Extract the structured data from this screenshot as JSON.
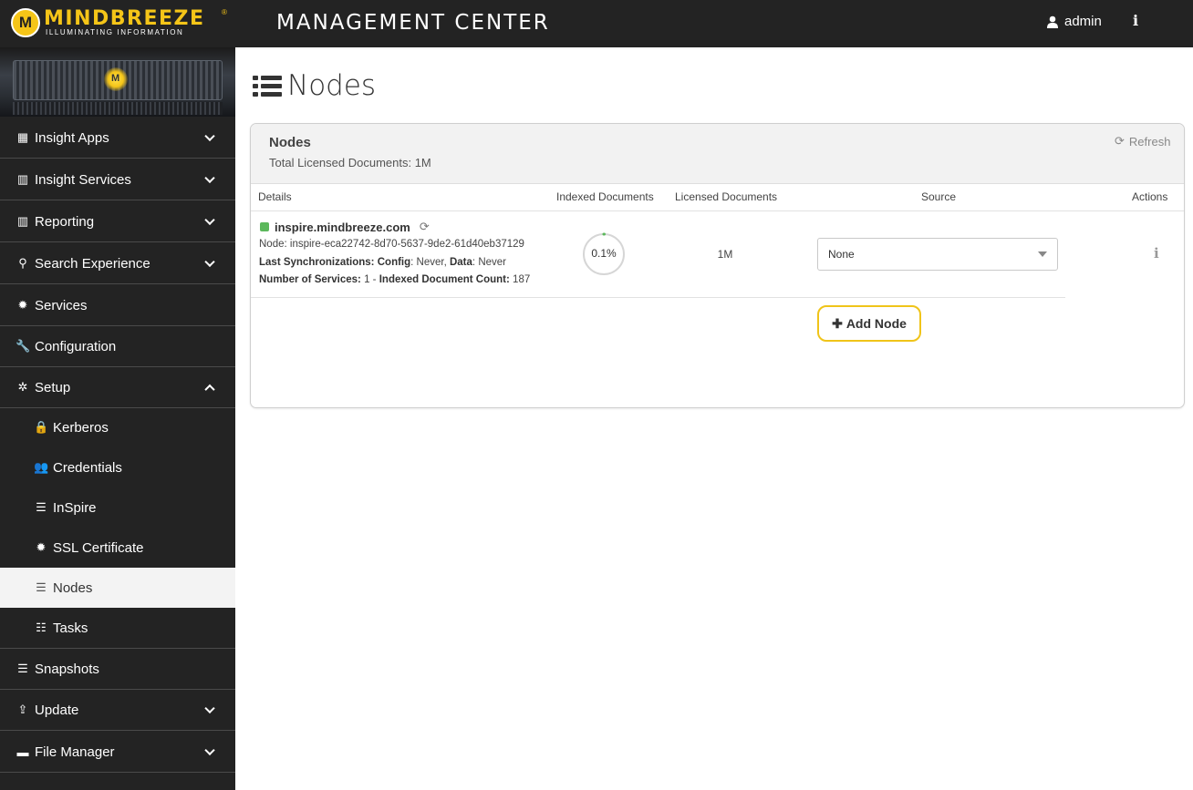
{
  "header": {
    "logo_name": "MINDBREEZE",
    "logo_reg": "®",
    "logo_tagline": "ILLUMINATING INFORMATION",
    "logo_letter": "M",
    "title": "MANAGEMENT CENTER",
    "user_label": "admin",
    "info_glyph": "i"
  },
  "sidebar": {
    "items": [
      {
        "label": "Insight Apps",
        "icon": "grid-icon",
        "glyph": "▦"
      },
      {
        "label": "Insight Services",
        "icon": "bar-chart-icon",
        "glyph": "▥"
      },
      {
        "label": "Reporting",
        "icon": "bar-chart-icon",
        "glyph": "▥"
      },
      {
        "label": "Search Experience",
        "icon": "search-icon",
        "glyph": "⚲"
      },
      {
        "label": "Services",
        "icon": "gear-icon",
        "glyph": "✹"
      },
      {
        "label": "Configuration",
        "icon": "wrench-icon",
        "glyph": "🔧"
      },
      {
        "label": "Setup",
        "icon": "gears-icon",
        "glyph": "✲"
      }
    ],
    "subitems": [
      {
        "label": "Kerberos",
        "icon": "lock-icon",
        "glyph": "🔒"
      },
      {
        "label": "Credentials",
        "icon": "users-icon",
        "glyph": "👥"
      },
      {
        "label": "InSpire",
        "icon": "server-icon",
        "glyph": "☰"
      },
      {
        "label": "SSL Certificate",
        "icon": "certificate-icon",
        "glyph": "✹"
      },
      {
        "label": "Nodes",
        "icon": "server-icon",
        "glyph": "☰"
      },
      {
        "label": "Tasks",
        "icon": "list-icon",
        "glyph": "☷"
      }
    ],
    "bottom_items": [
      {
        "label": "Snapshots",
        "icon": "server-icon",
        "glyph": "☰"
      },
      {
        "label": "Update",
        "icon": "upload-icon",
        "glyph": "⇪"
      },
      {
        "label": "File Manager",
        "icon": "folder-icon",
        "glyph": "▬"
      }
    ]
  },
  "main": {
    "page_title": "Nodes",
    "panel": {
      "title": "Nodes",
      "subtitle": "Total Licensed Documents: 1M",
      "refresh_label": "Refresh",
      "refresh_glyph": "⟳",
      "columns": [
        "Details",
        "Indexed Documents",
        "Licensed Documents",
        "Source",
        "Actions"
      ],
      "node": {
        "host": "inspire.mindbreeze.com",
        "sync_glyph": "⟳",
        "node_label": "Node:",
        "node_id": "inspire-eca22742-8d70-5637-9de2-61d40eb37129",
        "last_sync_label": "Last Synchronizations:",
        "config_label": "Config",
        "config_value": "Never,",
        "data_label": "Data",
        "data_value": "Never",
        "services_label": "Number of Services:",
        "services_value": "1",
        "dash": "-",
        "indexed_label": "Indexed Document Count:",
        "indexed_value": "187",
        "indexed_percent_label": "0.1%",
        "indexed_fraction": 0.001,
        "licensed": "1M",
        "source_value": "None",
        "actions_glyph": "i",
        "status_color": "#5cb85c"
      },
      "add_node_label": "Add Node",
      "add_node_glyph": "✚"
    }
  },
  "colors": {
    "accent": "#f5c518",
    "sidebar_bg": "#232323",
    "active_bg": "#f3f3f3"
  }
}
